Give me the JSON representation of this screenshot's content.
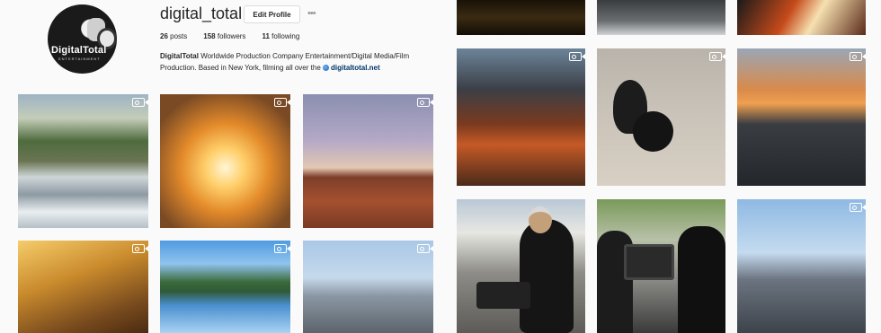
{
  "profile": {
    "username": "digital_total",
    "edit_label": "Edit Profile",
    "more_label": "•••",
    "avatar_logo": "DigitalTotal",
    "avatar_sub": "ENTERTAINMENT",
    "posts_count": "26",
    "posts_label": "posts",
    "followers_count": "158",
    "followers_label": "followers",
    "following_count": "11",
    "following_label": "following",
    "bio_name": "DigitalTotal",
    "bio_text": " Worldwide Production Company Entertainment/Digital Media/Film Production. Based in New York, filming all over the ",
    "bio_link": "digitaltotal.net"
  },
  "grid": {
    "icons": [
      "video-icon"
    ],
    "colors": {
      "accent_link": "#003569",
      "background": "#fafafa"
    }
  }
}
